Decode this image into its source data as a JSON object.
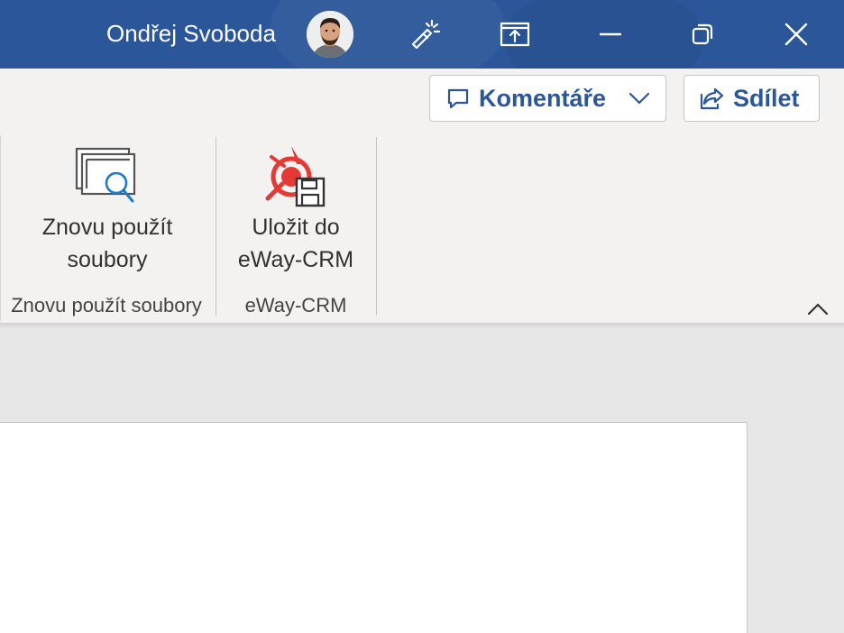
{
  "titlebar": {
    "user_name": "Ondřej Svoboda",
    "background_color": "#2b579a",
    "icons": [
      "avatar",
      "magic-wand-icon",
      "ribbon-display-options-icon",
      "minimize-icon",
      "restore-icon",
      "close-icon"
    ]
  },
  "header_actions": {
    "comments_label": "Komentáře",
    "share_label": "Sdílet",
    "accent_color": "#2b579a"
  },
  "ribbon": {
    "groups": [
      {
        "button_label_line1": "Znovu použít",
        "button_label_line2": "soubory",
        "group_label": "Znovu použít soubory",
        "icon": "reuse-files-icon"
      },
      {
        "button_label_line1": "Uložit do",
        "button_label_line2": "eWay-CRM",
        "group_label": "eWay-CRM",
        "icon": "eway-crm-save-icon"
      }
    ],
    "background_color": "#f3f2f1"
  }
}
